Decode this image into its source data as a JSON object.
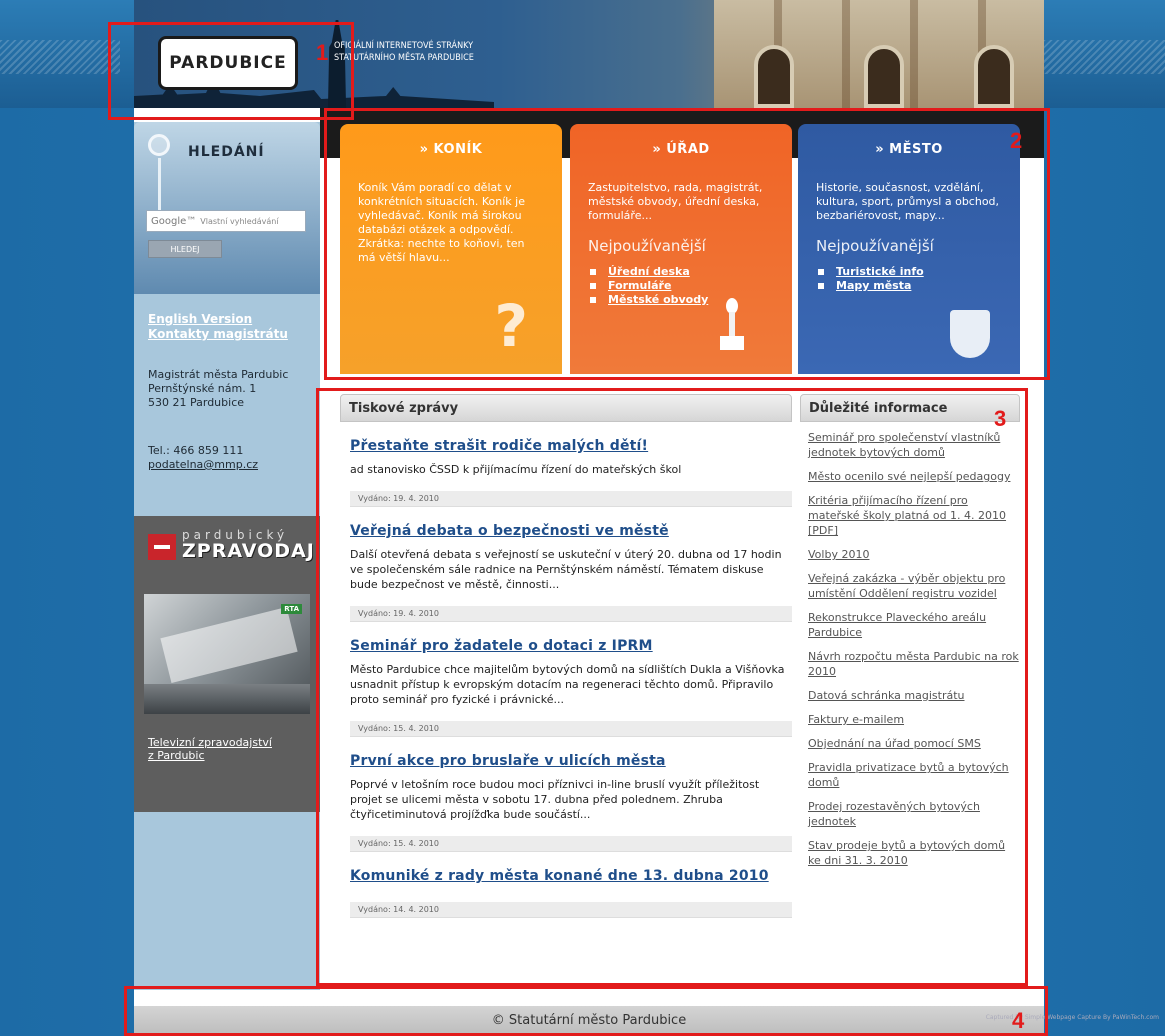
{
  "header": {
    "logo": "PARDUBICE",
    "tagline_line1": "OFICIÁLNÍ INTERNETOVÉ STRÁNKY",
    "tagline_line2": "STATUTÁRNÍHO MĚSTA PARDUBICE"
  },
  "search": {
    "title": "HLEDÁNÍ",
    "google_label": "Google™",
    "placeholder": "Vlastní vyhledávání",
    "button": "HLEDEJ"
  },
  "sidebar": {
    "links": [
      "English Version",
      "Kontakty magistrátu"
    ],
    "address": [
      "Magistrát města Pardubic",
      "Pernštýnské nám. 1",
      "530 21 Pardubice"
    ],
    "phone": "Tel.: 466 859 111",
    "email": "podatelna@mmp.cz",
    "zpravodaj_small": "pardubický",
    "zpravodaj_big": "ZPRAVODAJ",
    "tv_badge": "RTA",
    "tv_link_line1": "Televizní zpravodajství",
    "tv_link_line2": "z Pardubic"
  },
  "categories": {
    "konik": {
      "title": "» KONÍK",
      "text": "Koník Vám poradí co dělat v konkrétních situacích. Koník je vyhledávač. Koník má širokou databázi otázek a odpovědí. Zkrátka: nechte to koňovi, ten má větší hlavu..."
    },
    "urad": {
      "title": "» ÚŘAD",
      "text": "Zastupitelstvo, rada, magistrát, městské obvody, úřední deska, formuláře...",
      "sub": "Nejpoužívanější",
      "links": [
        "Úřední deska",
        "Formuláře",
        "Městské obvody"
      ]
    },
    "mesto": {
      "title": "» MĚSTO",
      "text": "Historie, současnost, vzdělání, kultura, sport, průmysl a obchod, bezbariérovost, mapy...",
      "sub": "Nejpoužívanější",
      "links": [
        "Turistické info",
        "Mapy města"
      ]
    }
  },
  "news": {
    "heading": "Tiskové zprávy",
    "items": [
      {
        "title": "Přestaňte strašit rodiče malých dětí!",
        "text": "ad stanovisko ČSSD k přijímacímu řízení do mateřských škol",
        "date": "Vydáno: 19. 4. 2010"
      },
      {
        "title": "Veřejná debata o bezpečnosti ve městě",
        "text": "Další otevřená debata s veřejností se uskuteční v úterý 20. dubna od 17 hodin ve společenském sále radnice na Pernštýnském náměstí. Tématem diskuse bude bezpečnost ve městě, činnosti...",
        "date": "Vydáno: 19. 4. 2010"
      },
      {
        "title": "Seminář pro žadatele o dotaci z IPRM",
        "text": "Město Pardubice chce majitelům bytových domů na sídlištích Dukla a Višňovka usnadnit přístup k evropským dotacím na regeneraci těchto domů. Připravilo proto seminář pro fyzické i právnické...",
        "date": "Vydáno: 15. 4. 2010"
      },
      {
        "title": "První akce pro bruslaře v ulicích města",
        "text": "Poprvé v letošním roce budou moci příznivci in-line bruslí využít příležitost projet se ulicemi města v sobotu 17. dubna před polednem. Zhruba čtyřicetiminutová projížďka bude součástí...",
        "date": "Vydáno: 15. 4. 2010"
      },
      {
        "title": "Komuniké z rady města konané dne 13. dubna 2010",
        "text": "",
        "date": "Vydáno: 14. 4. 2010"
      }
    ]
  },
  "info": {
    "heading": "Důležité informace",
    "links": [
      "Seminář pro společenství vlastníků jednotek bytových domů",
      "Město ocenilo své nejlepší pedagogy",
      "Kritéria přijímacího řízení pro mateřské školy platná od 1. 4. 2010 [PDF]",
      "Volby 2010",
      "Veřejná zakázka - výběr objektu pro umístění Oddělení registru vozidel",
      "Rekonstrukce Plaveckého areálu Pardubice",
      "Návrh rozpočtu města Pardubic na rok 2010",
      "Datová schránka magistrátu",
      "Faktury e-mailem",
      "Objednání na úřad pomocí SMS",
      "Pravidla privatizace bytů a bytových domů",
      "Prodej rozestavěných bytových jednotek",
      "Stav prodeje bytů a bytových domů ke dni 31. 3. 2010"
    ]
  },
  "footer": {
    "text": "© Statutární město Pardubice",
    "captured": "Captured By Simple Webpage Capture By PaWinTech.com"
  },
  "annotations": [
    "1",
    "2",
    "3",
    "4"
  ],
  "colors": {
    "konik": "#ff9a1a",
    "urad": "#f06426",
    "mesto": "#2f5aa2",
    "annotation": "#e21b1b",
    "link": "#1f4e8a"
  }
}
